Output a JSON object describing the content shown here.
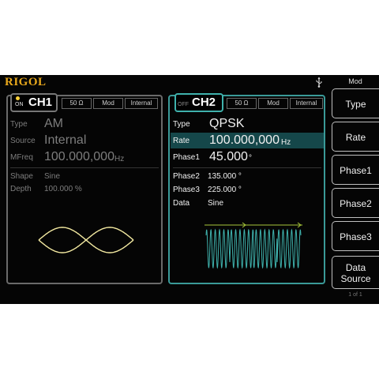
{
  "topbar": {
    "logo": "RIGOL",
    "mode": "Mod"
  },
  "ch1": {
    "name": "CH1",
    "status": "ON",
    "impedance": "50 Ω",
    "mode": "Mod",
    "source": "Internal",
    "rows": [
      {
        "label": "Type",
        "value": "AM"
      },
      {
        "label": "Source",
        "value": "Internal"
      },
      {
        "label": "MFreq",
        "value": "100.000,000",
        "unit": "Hz"
      },
      {
        "label": "Shape",
        "value": "Sine"
      },
      {
        "label": "Depth",
        "value": "100.000 %"
      }
    ]
  },
  "ch2": {
    "name": "CH2",
    "status": "OFF",
    "impedance": "50 Ω",
    "mode": "Mod",
    "source": "Internal",
    "rows": [
      {
        "label": "Type",
        "value": "QPSK"
      },
      {
        "label": "Rate",
        "value": "100.000,000",
        "unit": "Hz"
      },
      {
        "label": "Phase1",
        "value": "45.000",
        "unit": "°"
      },
      {
        "label": "Phase2",
        "value": "135.000 °"
      },
      {
        "label": "Phase3",
        "value": "225.000 °"
      },
      {
        "label": "Data",
        "value": "Sine"
      }
    ]
  },
  "softkeys": [
    "Type",
    "Rate",
    "Phase1",
    "Phase2",
    "Phase3",
    "Data Source"
  ],
  "page_indicator": "1 of 1",
  "colors": {
    "accent": "#3fb2ad",
    "selected_row": "#15474a",
    "waveform": "#f2e8a0",
    "logo": "#e8a81c"
  }
}
